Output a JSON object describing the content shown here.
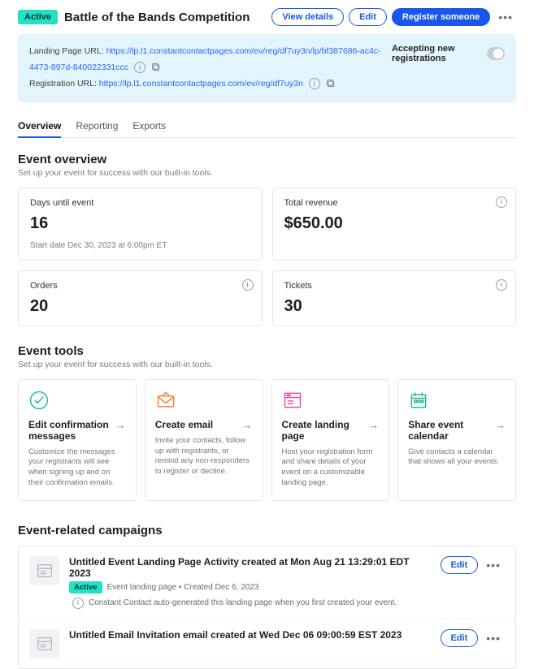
{
  "header": {
    "status_badge": "Active",
    "title": "Battle of the Bands Competition",
    "view_details_label": "View details",
    "edit_label": "Edit",
    "register_label": "Register someone"
  },
  "url_panel": {
    "landing_label": "Landing Page URL:",
    "landing_url": "https://lp.l1.constantcontactpages.com/ev/reg/df7uy3n/lp/bf387686-ac4c-4473-897d-840022331ccc",
    "registration_label": "Registration URL:",
    "registration_url": "https://lp.l1.constantcontactpages.com/ev/reg/df7uy3n",
    "accepting_label": "Accepting new registrations"
  },
  "tabs": [
    "Overview",
    "Reporting",
    "Exports"
  ],
  "overview": {
    "heading": "Event overview",
    "sub": "Set up your event for success with our built-in tools.",
    "cards": {
      "days": {
        "label": "Days until event",
        "value": "16",
        "extra_label": "Start date",
        "extra_value": "Dec 30, 2023 at 6:00pm ET"
      },
      "revenue": {
        "label": "Total revenue",
        "value": "$650.00"
      },
      "orders": {
        "label": "Orders",
        "value": "20"
      },
      "tickets": {
        "label": "Tickets",
        "value": "30"
      }
    }
  },
  "tools": {
    "heading": "Event tools",
    "sub": "Set up your event for success with our built-in tools.",
    "items": [
      {
        "title": "Edit confirmation messages",
        "desc": "Customize the messages your registrants will see when signing up and on their confirmation emails."
      },
      {
        "title": "Create email",
        "desc": "Invite your contacts, follow up with registrants, or remind any non-responders to register or decline."
      },
      {
        "title": "Create landing page",
        "desc": "Host your registration form and share details of your event on a customizable landing page."
      },
      {
        "title": "Share event calendar",
        "desc": "Give contacts a calendar that shows all your events."
      }
    ]
  },
  "campaigns": {
    "heading": "Event-related campaigns",
    "items": [
      {
        "title": "Untitled Event Landing Page Activity created at Mon Aug 21 13:29:01 EDT 2023",
        "status": "Active",
        "meta": "Event landing page  •  Created Dec 6, 2023",
        "note": "Constant Contact auto-generated this landing page when you first created your event.",
        "edit_label": "Edit"
      },
      {
        "title": "Untitled Email Invitation email created at Wed Dec 06 09:00:59 EST 2023",
        "edit_label": "Edit"
      }
    ]
  }
}
